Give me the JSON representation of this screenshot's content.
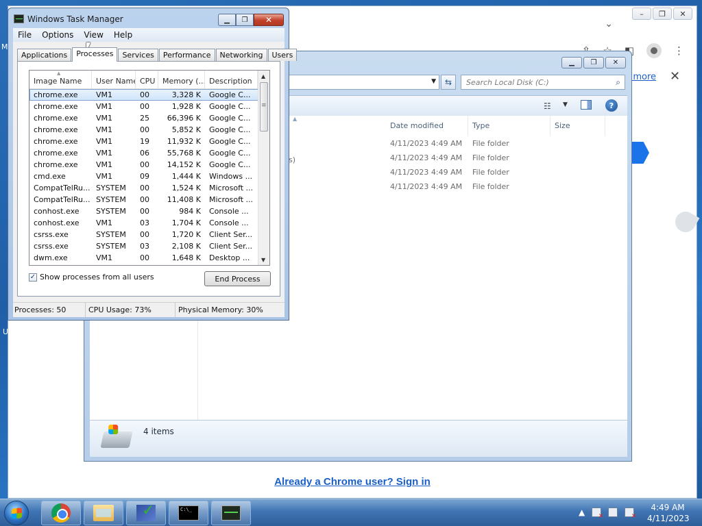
{
  "chrome": {
    "learn_more": "n more",
    "sign_in": "Already a Chrome user? Sign in"
  },
  "explorer": {
    "search_placeholder": "Search Local Disk (C:)",
    "headers": [
      "Date modified",
      "Type",
      "Size"
    ],
    "rows": [
      {
        "date": "4/11/2023 4:49 AM",
        "type": "File folder"
      },
      {
        "date": "4/11/2023 4:49 AM",
        "type": "File folder"
      },
      {
        "date": "4/11/2023 4:49 AM",
        "type": "File folder"
      },
      {
        "date": "4/11/2023 4:49 AM",
        "type": "File folder"
      }
    ],
    "stray_text": "s)",
    "item_count": "4 items"
  },
  "taskmgr": {
    "title": "Windows Task Manager",
    "menu": [
      "File",
      "Options",
      "View",
      "Help"
    ],
    "tabs": [
      "Applications",
      "Processes",
      "Services",
      "Performance",
      "Networking",
      "Users"
    ],
    "columns": [
      "Image Name",
      "User Name",
      "CPU",
      "Memory (...",
      "Description"
    ],
    "processes": [
      {
        "name": "chrome.exe",
        "user": "VM1",
        "cpu": "00",
        "mem": "3,328 K",
        "desc": "Google C..."
      },
      {
        "name": "chrome.exe",
        "user": "VM1",
        "cpu": "00",
        "mem": "1,928 K",
        "desc": "Google C..."
      },
      {
        "name": "chrome.exe",
        "user": "VM1",
        "cpu": "25",
        "mem": "66,396 K",
        "desc": "Google C..."
      },
      {
        "name": "chrome.exe",
        "user": "VM1",
        "cpu": "00",
        "mem": "5,852 K",
        "desc": "Google C..."
      },
      {
        "name": "chrome.exe",
        "user": "VM1",
        "cpu": "19",
        "mem": "11,932 K",
        "desc": "Google C..."
      },
      {
        "name": "chrome.exe",
        "user": "VM1",
        "cpu": "06",
        "mem": "55,768 K",
        "desc": "Google C..."
      },
      {
        "name": "chrome.exe",
        "user": "VM1",
        "cpu": "00",
        "mem": "14,152 K",
        "desc": "Google C..."
      },
      {
        "name": "cmd.exe",
        "user": "VM1",
        "cpu": "09",
        "mem": "1,444 K",
        "desc": "Windows ..."
      },
      {
        "name": "CompatTelRu...",
        "user": "SYSTEM",
        "cpu": "00",
        "mem": "1,524 K",
        "desc": "Microsoft ..."
      },
      {
        "name": "CompatTelRu...",
        "user": "SYSTEM",
        "cpu": "00",
        "mem": "11,408 K",
        "desc": "Microsoft ..."
      },
      {
        "name": "conhost.exe",
        "user": "SYSTEM",
        "cpu": "00",
        "mem": "984 K",
        "desc": "Console ..."
      },
      {
        "name": "conhost.exe",
        "user": "VM1",
        "cpu": "03",
        "mem": "1,704 K",
        "desc": "Console ..."
      },
      {
        "name": "csrss.exe",
        "user": "SYSTEM",
        "cpu": "00",
        "mem": "1,720 K",
        "desc": "Client Ser..."
      },
      {
        "name": "csrss.exe",
        "user": "SYSTEM",
        "cpu": "03",
        "mem": "2,108 K",
        "desc": "Client Ser..."
      },
      {
        "name": "dwm.exe",
        "user": "VM1",
        "cpu": "00",
        "mem": "1,648 K",
        "desc": "Desktop ..."
      }
    ],
    "show_all_label": "Show processes from all users",
    "end_process": "End Process",
    "status": {
      "processes": "Processes: 50",
      "cpu": "CPU Usage: 73%",
      "memory": "Physical Memory: 30%"
    }
  },
  "taskbar": {
    "time": "4:49 AM",
    "date": "4/11/2023"
  }
}
